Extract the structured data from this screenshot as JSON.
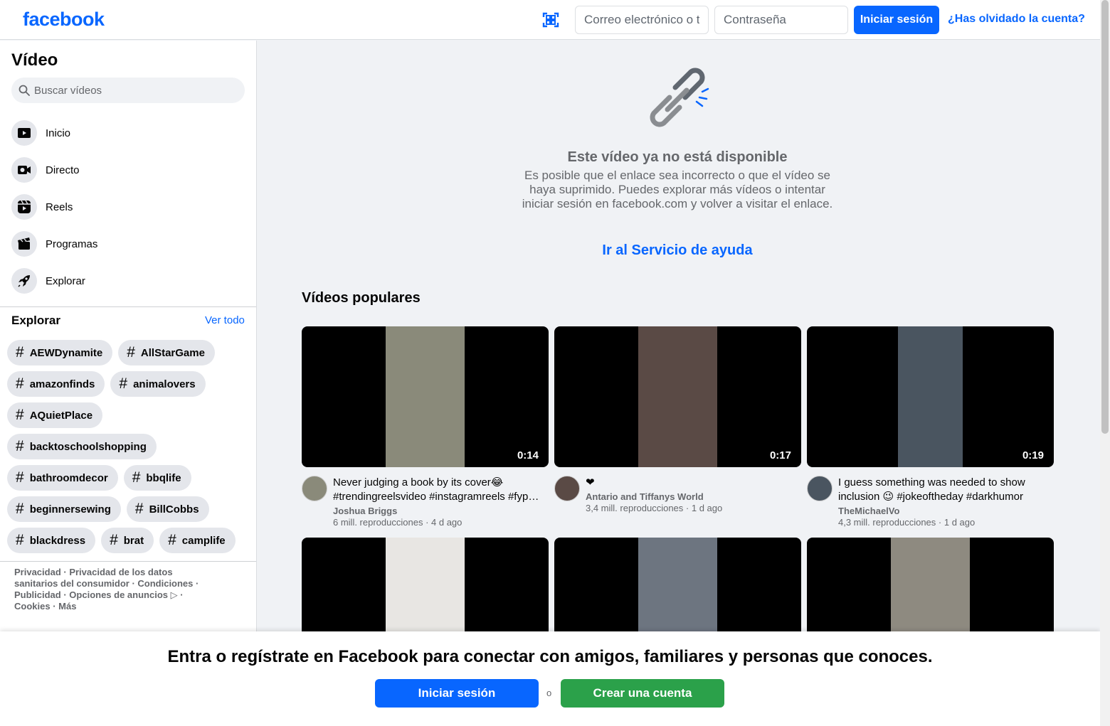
{
  "header": {
    "logo": "facebook",
    "email_placeholder": "Correo electrónico o teléfono",
    "password_placeholder": "Contraseña",
    "login_label": "Iniciar sesión",
    "forgot_label": "¿Has olvidado la cuenta?"
  },
  "sidebar": {
    "title": "Vídeo",
    "search_placeholder": "Buscar vídeos",
    "nav": [
      {
        "label": "Inicio",
        "icon": "play-icon"
      },
      {
        "label": "Directo",
        "icon": "live-camera-icon"
      },
      {
        "label": "Reels",
        "icon": "reels-icon"
      },
      {
        "label": "Programas",
        "icon": "clapperboard-icon"
      },
      {
        "label": "Explorar",
        "icon": "rocket-icon"
      }
    ],
    "explore_title": "Explorar",
    "see_all": "Ver todo",
    "tags": [
      "AEWDynamite",
      "AllStarGame",
      "amazonfinds",
      "animalovers",
      "AQuietPlace",
      "backtoschoolshopping",
      "bathroomdecor",
      "bbqlife",
      "beginnersewing",
      "BillCobbs",
      "blackdress",
      "brat",
      "camplife"
    ],
    "footer": {
      "privacy": "Privacidad",
      "health_privacy": "Privacidad de los datos sanitarios del consumidor",
      "terms": "Condiciones",
      "ads": "Publicidad",
      "ad_choices": "Opciones de anuncios ▷",
      "cookies": "Cookies",
      "more": "Más"
    }
  },
  "unavailable": {
    "title": "Este vídeo ya no está disponible",
    "text": "Es posible que el enlace sea incorrecto o que el vídeo se haya suprimido. Puedes explorar más vídeos o intentar iniciar sesión en facebook.com y volver a visitar el enlace.",
    "help_link": "Ir al Servicio de ayuda"
  },
  "popular": {
    "title": "Vídeos populares",
    "videos": [
      {
        "title": "Never judging a book by its cover😂 #trendingreelsvideo #instagramreels #fyp…",
        "author": "Joshua Briggs",
        "views": "6 mill. reproducciones",
        "age": "4 d ago",
        "duration": "0:14",
        "thumb_color": "#8a8a7a"
      },
      {
        "title": "❤",
        "author": "Antario and Tiffanys World",
        "views": "3,4 mill. reproducciones",
        "age": "1 d ago",
        "duration": "0:17",
        "thumb_color": "#5a4a45"
      },
      {
        "title": "I guess something was needed to show inclusion 😉 #jokeoftheday #darkhumor #mvo",
        "author": "TheMichaelVo",
        "views": "4,3 mill. reproducciones",
        "age": "1 d ago",
        "duration": "0:19",
        "thumb_color": "#4a5560"
      },
      {
        "title": "",
        "author": "",
        "views": "",
        "age": "",
        "duration": "",
        "thumb_color": "#e8e6e3"
      },
      {
        "title": "",
        "author": "",
        "views": "",
        "age": "",
        "duration": "",
        "thumb_color": "#6d7580"
      },
      {
        "title": "",
        "author": "",
        "views": "",
        "age": "",
        "duration": "",
        "thumb_color": "#8e8a80"
      }
    ]
  },
  "banner": {
    "text": "Entra o regístrate en Facebook para conectar con amigos, familiares y personas que conoces.",
    "login_label": "Iniciar sesión",
    "or": "o",
    "create_label": "Crear una cuenta"
  },
  "colors": {
    "brand": "#0866ff",
    "create": "#2ba14a"
  }
}
